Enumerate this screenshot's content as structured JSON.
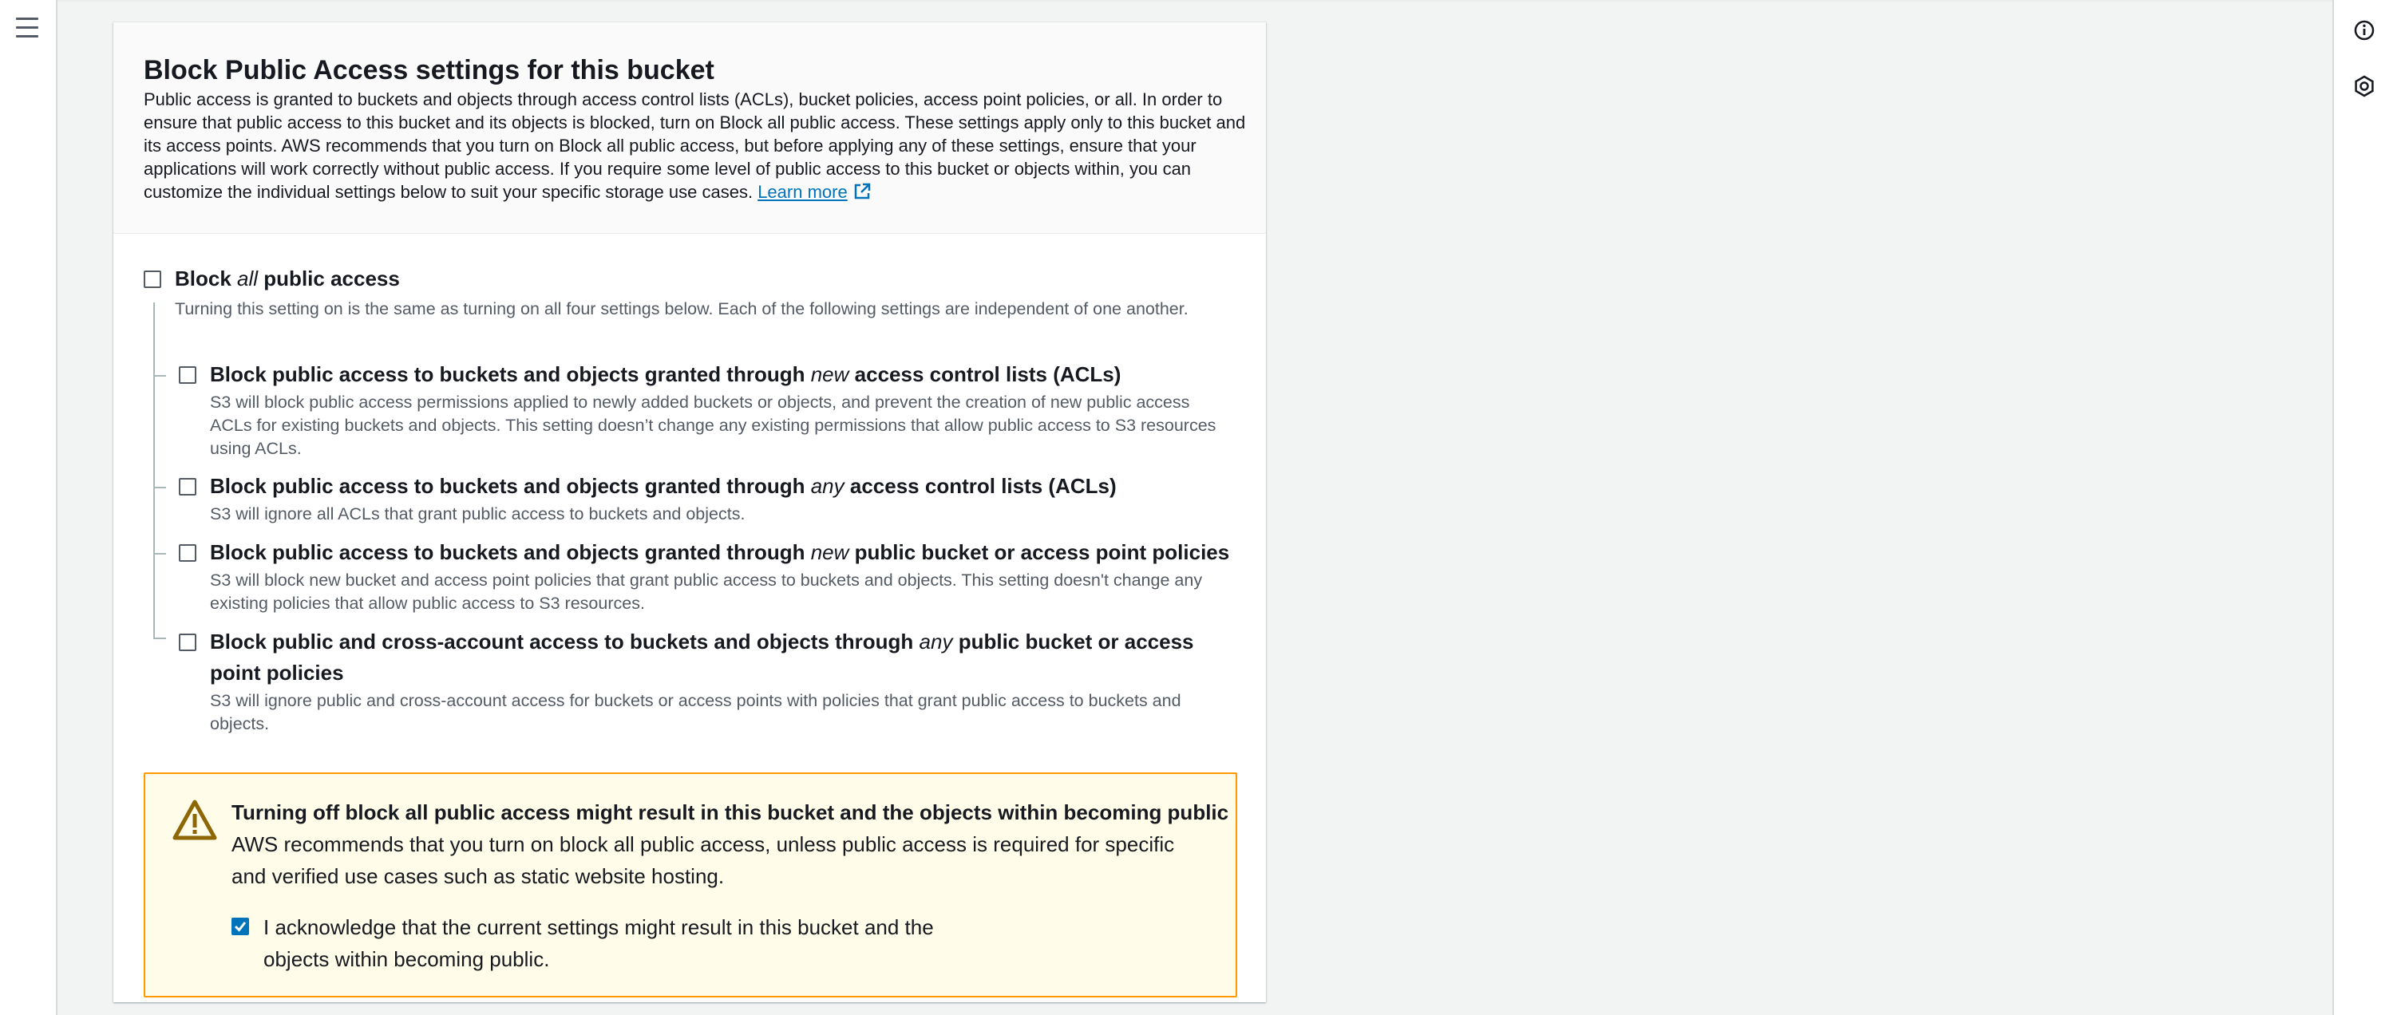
{
  "panel": {
    "title": "Block Public Access settings for this bucket",
    "description": "Public access is granted to buckets and objects through access control lists (ACLs), bucket policies, access point policies, or all. In order to ensure that public access to this bucket and its objects is blocked, turn on Block all public access. These settings apply only to this bucket and its access points. AWS recommends that you turn on Block all public access, but before applying any of these settings, ensure that your applications will work correctly without public access. If you require some level of public access to this bucket or objects within, you can customize the individual settings below to suit your specific storage use cases.",
    "learn_more": "Learn more",
    "learn_more_icon": "external-link-icon"
  },
  "block_all": {
    "title_pre": "Block",
    "title_em": "all",
    "title_post": "public access",
    "description": "Turning this setting on is the same as turning on all four settings below. Each of the following settings are independent of one another.",
    "checked": false
  },
  "options": [
    {
      "title_pre": "Block public access to buckets and objects granted through",
      "title_em": "new",
      "title_post": "access control lists (ACLs)",
      "description": "S3 will block public access permissions applied to newly added buckets or objects, and prevent the creation of new public access ACLs for existing buckets and objects. This setting doesn’t change any existing permissions that allow public access to S3 resources using ACLs.",
      "checked": false
    },
    {
      "title_pre": "Block public access to buckets and objects granted through",
      "title_em": "any",
      "title_post": "access control lists (ACLs)",
      "description": "S3 will ignore all ACLs that grant public access to buckets and objects.",
      "checked": false
    },
    {
      "title_pre": "Block public access to buckets and objects granted through",
      "title_em": "new",
      "title_post": "public bucket or access point policies",
      "description": "S3 will block new bucket and access point policies that grant public access to buckets and objects. This setting doesn't change any existing policies that allow public access to S3 resources.",
      "checked": false
    },
    {
      "title_pre": "Block public and cross-account access to buckets and objects through",
      "title_em": "any",
      "title_post": "public bucket or access point policies",
      "description": "S3 will ignore public and cross-account access for buckets or access points with policies that grant public access to buckets and objects.",
      "checked": false
    }
  ],
  "warning": {
    "icon": "warning-triangle-icon",
    "title": "Turning off block all public access might result in this bucket and the objects within becoming public",
    "text": "AWS recommends that you turn on block all public access, unless public access is required for specific and verified use cases such as static website hosting.",
    "ack_label": "I acknowledge that the current settings might result in this bucket and the objects within becoming public.",
    "ack_checked": true
  },
  "icons": {
    "menu": "hamburger-menu-icon",
    "info": "info-icon",
    "settings": "settings-hexagon-icon"
  },
  "colors": {
    "link": "#0073bb",
    "warning_border": "#ff9900",
    "warning_bg": "#fffce9",
    "warning_icon": "#8d6605",
    "checkbox_checked": "#0073bb"
  }
}
